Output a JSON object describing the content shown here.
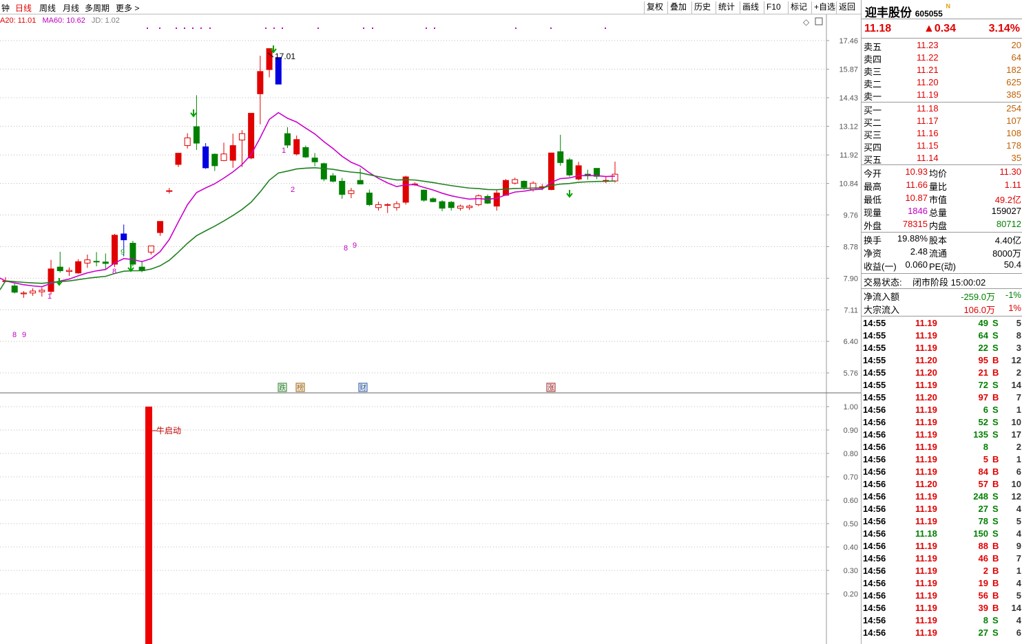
{
  "tabs": [
    "钟",
    "日线",
    "周线",
    "月线",
    "多周期",
    "更多"
  ],
  "active_tab": 1,
  "toolbar": [
    "复权",
    "叠加",
    "历史",
    "统计",
    "画线",
    "F10",
    "标记",
    "+自选",
    "返回"
  ],
  "ma_legend": {
    "ma20": "A20: 11.01",
    "ma60": "MA60: 10.62",
    "jd": "JD: 1.02"
  },
  "stock": {
    "name": "迎丰股份",
    "code": "605055",
    "badge": "N",
    "price": "11.18",
    "change": "▲0.34",
    "pct": "3.14%"
  },
  "asks": [
    {
      "label": "卖五",
      "price": "11.23",
      "vol": "20"
    },
    {
      "label": "卖四",
      "price": "11.22",
      "vol": "64"
    },
    {
      "label": "卖三",
      "price": "11.21",
      "vol": "182"
    },
    {
      "label": "卖二",
      "price": "11.20",
      "vol": "625"
    },
    {
      "label": "卖一",
      "price": "11.19",
      "vol": "385"
    }
  ],
  "bids": [
    {
      "label": "买一",
      "price": "11.18",
      "vol": "254"
    },
    {
      "label": "买二",
      "price": "11.17",
      "vol": "107"
    },
    {
      "label": "买三",
      "price": "11.16",
      "vol": "108"
    },
    {
      "label": "买四",
      "price": "11.15",
      "vol": "178"
    },
    {
      "label": "买五",
      "price": "11.14",
      "vol": "35"
    }
  ],
  "stats": [
    {
      "l1": "今开",
      "v1": "10.93",
      "l2": "均价",
      "v2": "11.30"
    },
    {
      "l1": "最高",
      "v1": "11.66",
      "l2": "量比",
      "v2": "1.11"
    },
    {
      "l1": "最低",
      "v1": "10.87",
      "l2": "市值",
      "v2": "49.2亿"
    },
    {
      "l1": "现量",
      "v1": "1846",
      "l2": "总量",
      "v2": "159027"
    },
    {
      "l1": "外盘",
      "v1": "78315",
      "l2": "内盘",
      "v2": "80712"
    }
  ],
  "stats2": [
    {
      "l1": "换手",
      "v1": "19.88%",
      "l2": "股本",
      "v2": "4.40亿"
    },
    {
      "l1": "净资",
      "v1": "2.48",
      "l2": "流通",
      "v2": "8000万"
    },
    {
      "l1": "收益(一)",
      "v1": "0.060",
      "l2": "PE(动)",
      "v2": "50.4"
    }
  ],
  "trade_status": {
    "label": "交易状态:",
    "value": "闭市阶段 15:00:02"
  },
  "flows": [
    {
      "label": "净流入额",
      "value": "-259.0万",
      "pct": "-1%"
    },
    {
      "label": "大宗流入",
      "value": "106.0万",
      "pct": "1%"
    }
  ],
  "ticks": [
    {
      "t": "14:55",
      "p": "11.19",
      "v": "49",
      "s": "S",
      "n": "5"
    },
    {
      "t": "14:55",
      "p": "11.19",
      "v": "64",
      "s": "S",
      "n": "8"
    },
    {
      "t": "14:55",
      "p": "11.19",
      "v": "22",
      "s": "S",
      "n": "3"
    },
    {
      "t": "14:55",
      "p": "11.20",
      "v": "95",
      "s": "B",
      "n": "12"
    },
    {
      "t": "14:55",
      "p": "11.20",
      "v": "21",
      "s": "B",
      "n": "2"
    },
    {
      "t": "14:55",
      "p": "11.19",
      "v": "72",
      "s": "S",
      "n": "14"
    },
    {
      "t": "14:55",
      "p": "11.20",
      "v": "97",
      "s": "B",
      "n": "7"
    },
    {
      "t": "14:56",
      "p": "11.19",
      "v": "6",
      "s": "S",
      "n": "1"
    },
    {
      "t": "14:56",
      "p": "11.19",
      "v": "52",
      "s": "S",
      "n": "10"
    },
    {
      "t": "14:56",
      "p": "11.19",
      "v": "135",
      "s": "S",
      "n": "17"
    },
    {
      "t": "14:56",
      "p": "11.19",
      "v": "8",
      "s": "",
      "n": "2"
    },
    {
      "t": "14:56",
      "p": "11.19",
      "v": "5",
      "s": "B",
      "n": "1"
    },
    {
      "t": "14:56",
      "p": "11.19",
      "v": "84",
      "s": "B",
      "n": "6"
    },
    {
      "t": "14:56",
      "p": "11.20",
      "v": "57",
      "s": "B",
      "n": "10"
    },
    {
      "t": "14:56",
      "p": "11.19",
      "v": "248",
      "s": "S",
      "n": "12"
    },
    {
      "t": "14:56",
      "p": "11.19",
      "v": "27",
      "s": "S",
      "n": "4"
    },
    {
      "t": "14:56",
      "p": "11.19",
      "v": "78",
      "s": "S",
      "n": "5"
    },
    {
      "t": "14:56",
      "p": "11.18",
      "v": "150",
      "s": "S",
      "n": "4"
    },
    {
      "t": "14:56",
      "p": "11.19",
      "v": "88",
      "s": "B",
      "n": "9"
    },
    {
      "t": "14:56",
      "p": "11.19",
      "v": "46",
      "s": "B",
      "n": "7"
    },
    {
      "t": "14:56",
      "p": "11.19",
      "v": "2",
      "s": "B",
      "n": "1"
    },
    {
      "t": "14:56",
      "p": "11.19",
      "v": "19",
      "s": "B",
      "n": "4"
    },
    {
      "t": "14:56",
      "p": "11.19",
      "v": "56",
      "s": "B",
      "n": "5"
    },
    {
      "t": "14:56",
      "p": "11.19",
      "v": "39",
      "s": "B",
      "n": "14"
    },
    {
      "t": "14:56",
      "p": "11.19",
      "v": "8",
      "s": "S",
      "n": "4"
    },
    {
      "t": "14:56",
      "p": "11.19",
      "v": "27",
      "s": "S",
      "n": "6"
    }
  ],
  "chart_data": {
    "type": "candlestick",
    "price_axis": {
      "ticks": [
        "17.46",
        "15.87",
        "14.43",
        "13.12",
        "11.92",
        "10.84",
        "9.76",
        "8.78",
        "7.90",
        "7.11",
        "6.40",
        "5.76"
      ],
      "scale": "log"
    },
    "indicator_axis": {
      "ticks": [
        "1.00",
        "0.90",
        "0.80",
        "0.70",
        "0.60",
        "0.50",
        "0.40",
        "0.30",
        "0.20"
      ]
    },
    "annotations": {
      "high_label": "17.01",
      "indicator_label": "牛启动",
      "event_markers": [
        "跌",
        "榜",
        "财",
        "涨"
      ]
    },
    "candles": [
      {
        "o": 7.83,
        "h": 7.93,
        "l": 7.8,
        "c": 7.83
      },
      {
        "o": 7.7,
        "h": 7.76,
        "l": 7.51,
        "c": 7.54
      },
      {
        "o": 7.5,
        "h": 7.57,
        "l": 7.4,
        "c": 7.52
      },
      {
        "o": 7.52,
        "h": 7.64,
        "l": 7.45,
        "c": 7.57
      },
      {
        "o": 7.55,
        "h": 7.66,
        "l": 7.43,
        "c": 7.59
      },
      {
        "o": 7.56,
        "h": 8.4,
        "l": 7.48,
        "c": 8.15
      },
      {
        "o": 8.2,
        "h": 8.63,
        "l": 8.05,
        "c": 8.1
      },
      {
        "o": 8.08,
        "h": 8.19,
        "l": 7.96,
        "c": 8.11
      },
      {
        "o": 8.04,
        "h": 8.42,
        "l": 8.02,
        "c": 8.35
      },
      {
        "o": 8.31,
        "h": 8.55,
        "l": 8.18,
        "c": 8.4
      },
      {
        "o": 8.36,
        "h": 8.62,
        "l": 8.22,
        "c": 8.34
      },
      {
        "o": 8.34,
        "h": 8.58,
        "l": 8.12,
        "c": 8.3
      },
      {
        "o": 8.28,
        "h": 9.16,
        "l": 8.2,
        "c": 9.12
      },
      {
        "o": 9.16,
        "h": 9.45,
        "l": 8.5,
        "c": 8.98
      },
      {
        "o": 8.88,
        "h": 8.95,
        "l": 8.22,
        "c": 8.28
      },
      {
        "o": 8.2,
        "h": 8.37,
        "l": 8.06,
        "c": 8.1
      },
      {
        "o": 8.62,
        "h": 8.8,
        "l": 8.55,
        "c": 8.8
      },
      {
        "o": 9.2,
        "h": 9.55,
        "l": 9.1,
        "c": 9.55
      },
      {
        "o": 10.58,
        "h": 10.68,
        "l": 10.48,
        "c": 10.58
      },
      {
        "o": 11.55,
        "h": 12.0,
        "l": 11.45,
        "c": 11.99
      },
      {
        "o": 12.3,
        "h": 12.82,
        "l": 12.18,
        "c": 12.62
      },
      {
        "o": 13.1,
        "h": 14.55,
        "l": 12.12,
        "c": 12.4
      },
      {
        "o": 12.25,
        "h": 12.4,
        "l": 11.38,
        "c": 11.42
      },
      {
        "o": 11.95,
        "h": 11.98,
        "l": 11.3,
        "c": 11.5
      },
      {
        "o": 11.7,
        "h": 12.42,
        "l": 11.68,
        "c": 11.96
      },
      {
        "o": 11.71,
        "h": 12.8,
        "l": 11.42,
        "c": 12.3
      },
      {
        "o": 12.53,
        "h": 12.95,
        "l": 11.45,
        "c": 12.8
      },
      {
        "o": 11.8,
        "h": 13.7,
        "l": 11.75,
        "c": 13.7
      },
      {
        "o": 14.62,
        "h": 16.6,
        "l": 13.2,
        "c": 15.75
      },
      {
        "o": 15.85,
        "h": 17.01,
        "l": 15.45,
        "c": 17.0
      },
      {
        "o": 16.5,
        "h": 16.5,
        "l": 15.1,
        "c": 15.1
      },
      {
        "o": 12.8,
        "h": 13.08,
        "l": 12.2,
        "c": 12.32
      },
      {
        "o": 11.96,
        "h": 12.72,
        "l": 11.9,
        "c": 12.55
      },
      {
        "o": 12.22,
        "h": 12.3,
        "l": 11.8,
        "c": 11.84
      },
      {
        "o": 11.8,
        "h": 12.0,
        "l": 11.48,
        "c": 11.65
      },
      {
        "o": 11.58,
        "h": 11.62,
        "l": 10.92,
        "c": 11.0
      },
      {
        "o": 11.12,
        "h": 11.22,
        "l": 10.88,
        "c": 10.92
      },
      {
        "o": 10.92,
        "h": 11.04,
        "l": 10.3,
        "c": 10.45
      },
      {
        "o": 10.48,
        "h": 10.68,
        "l": 10.32,
        "c": 10.58
      },
      {
        "o": 10.95,
        "h": 11.4,
        "l": 10.85,
        "c": 10.82
      },
      {
        "o": 10.5,
        "h": 10.62,
        "l": 10.05,
        "c": 10.1
      },
      {
        "o": 10.0,
        "h": 10.2,
        "l": 9.9,
        "c": 10.1
      },
      {
        "o": 10.08,
        "h": 10.15,
        "l": 9.82,
        "c": 10.1
      },
      {
        "o": 10.0,
        "h": 10.22,
        "l": 9.9,
        "c": 10.13
      },
      {
        "o": 10.18,
        "h": 11.12,
        "l": 10.1,
        "c": 11.08
      },
      {
        "o": 10.8,
        "h": 10.88,
        "l": 10.75,
        "c": 10.82
      },
      {
        "o": 10.6,
        "h": 10.62,
        "l": 10.2,
        "c": 10.25
      },
      {
        "o": 10.3,
        "h": 10.35,
        "l": 10.18,
        "c": 10.2
      },
      {
        "o": 10.2,
        "h": 10.25,
        "l": 9.88,
        "c": 9.98
      },
      {
        "o": 10.18,
        "h": 10.22,
        "l": 9.9,
        "c": 10.0
      },
      {
        "o": 9.98,
        "h": 10.1,
        "l": 9.9,
        "c": 10.05
      },
      {
        "o": 10.0,
        "h": 10.1,
        "l": 9.92,
        "c": 10.05
      },
      {
        "o": 10.1,
        "h": 10.45,
        "l": 10.05,
        "c": 10.4
      },
      {
        "o": 10.38,
        "h": 10.45,
        "l": 10.12,
        "c": 10.15
      },
      {
        "o": 10.05,
        "h": 10.6,
        "l": 9.9,
        "c": 10.5
      },
      {
        "o": 10.42,
        "h": 11.0,
        "l": 10.4,
        "c": 10.95
      },
      {
        "o": 10.85,
        "h": 11.05,
        "l": 10.8,
        "c": 10.98
      },
      {
        "o": 10.92,
        "h": 10.95,
        "l": 10.62,
        "c": 10.7
      },
      {
        "o": 10.62,
        "h": 10.92,
        "l": 10.55,
        "c": 10.85
      },
      {
        "o": 10.7,
        "h": 10.82,
        "l": 10.6,
        "c": 10.72
      },
      {
        "o": 10.62,
        "h": 12.0,
        "l": 10.6,
        "c": 12.0
      },
      {
        "o": 12.05,
        "h": 12.75,
        "l": 11.5,
        "c": 11.62
      },
      {
        "o": 11.73,
        "h": 11.8,
        "l": 11.08,
        "c": 11.15
      },
      {
        "o": 11.0,
        "h": 11.65,
        "l": 10.95,
        "c": 11.5
      },
      {
        "o": 11.18,
        "h": 11.35,
        "l": 10.98,
        "c": 11.15
      },
      {
        "o": 11.4,
        "h": 11.4,
        "l": 11.0,
        "c": 11.1
      },
      {
        "o": 10.95,
        "h": 11.08,
        "l": 10.85,
        "c": 10.95
      },
      {
        "o": 10.93,
        "h": 11.66,
        "l": 10.87,
        "c": 11.18
      }
    ]
  }
}
